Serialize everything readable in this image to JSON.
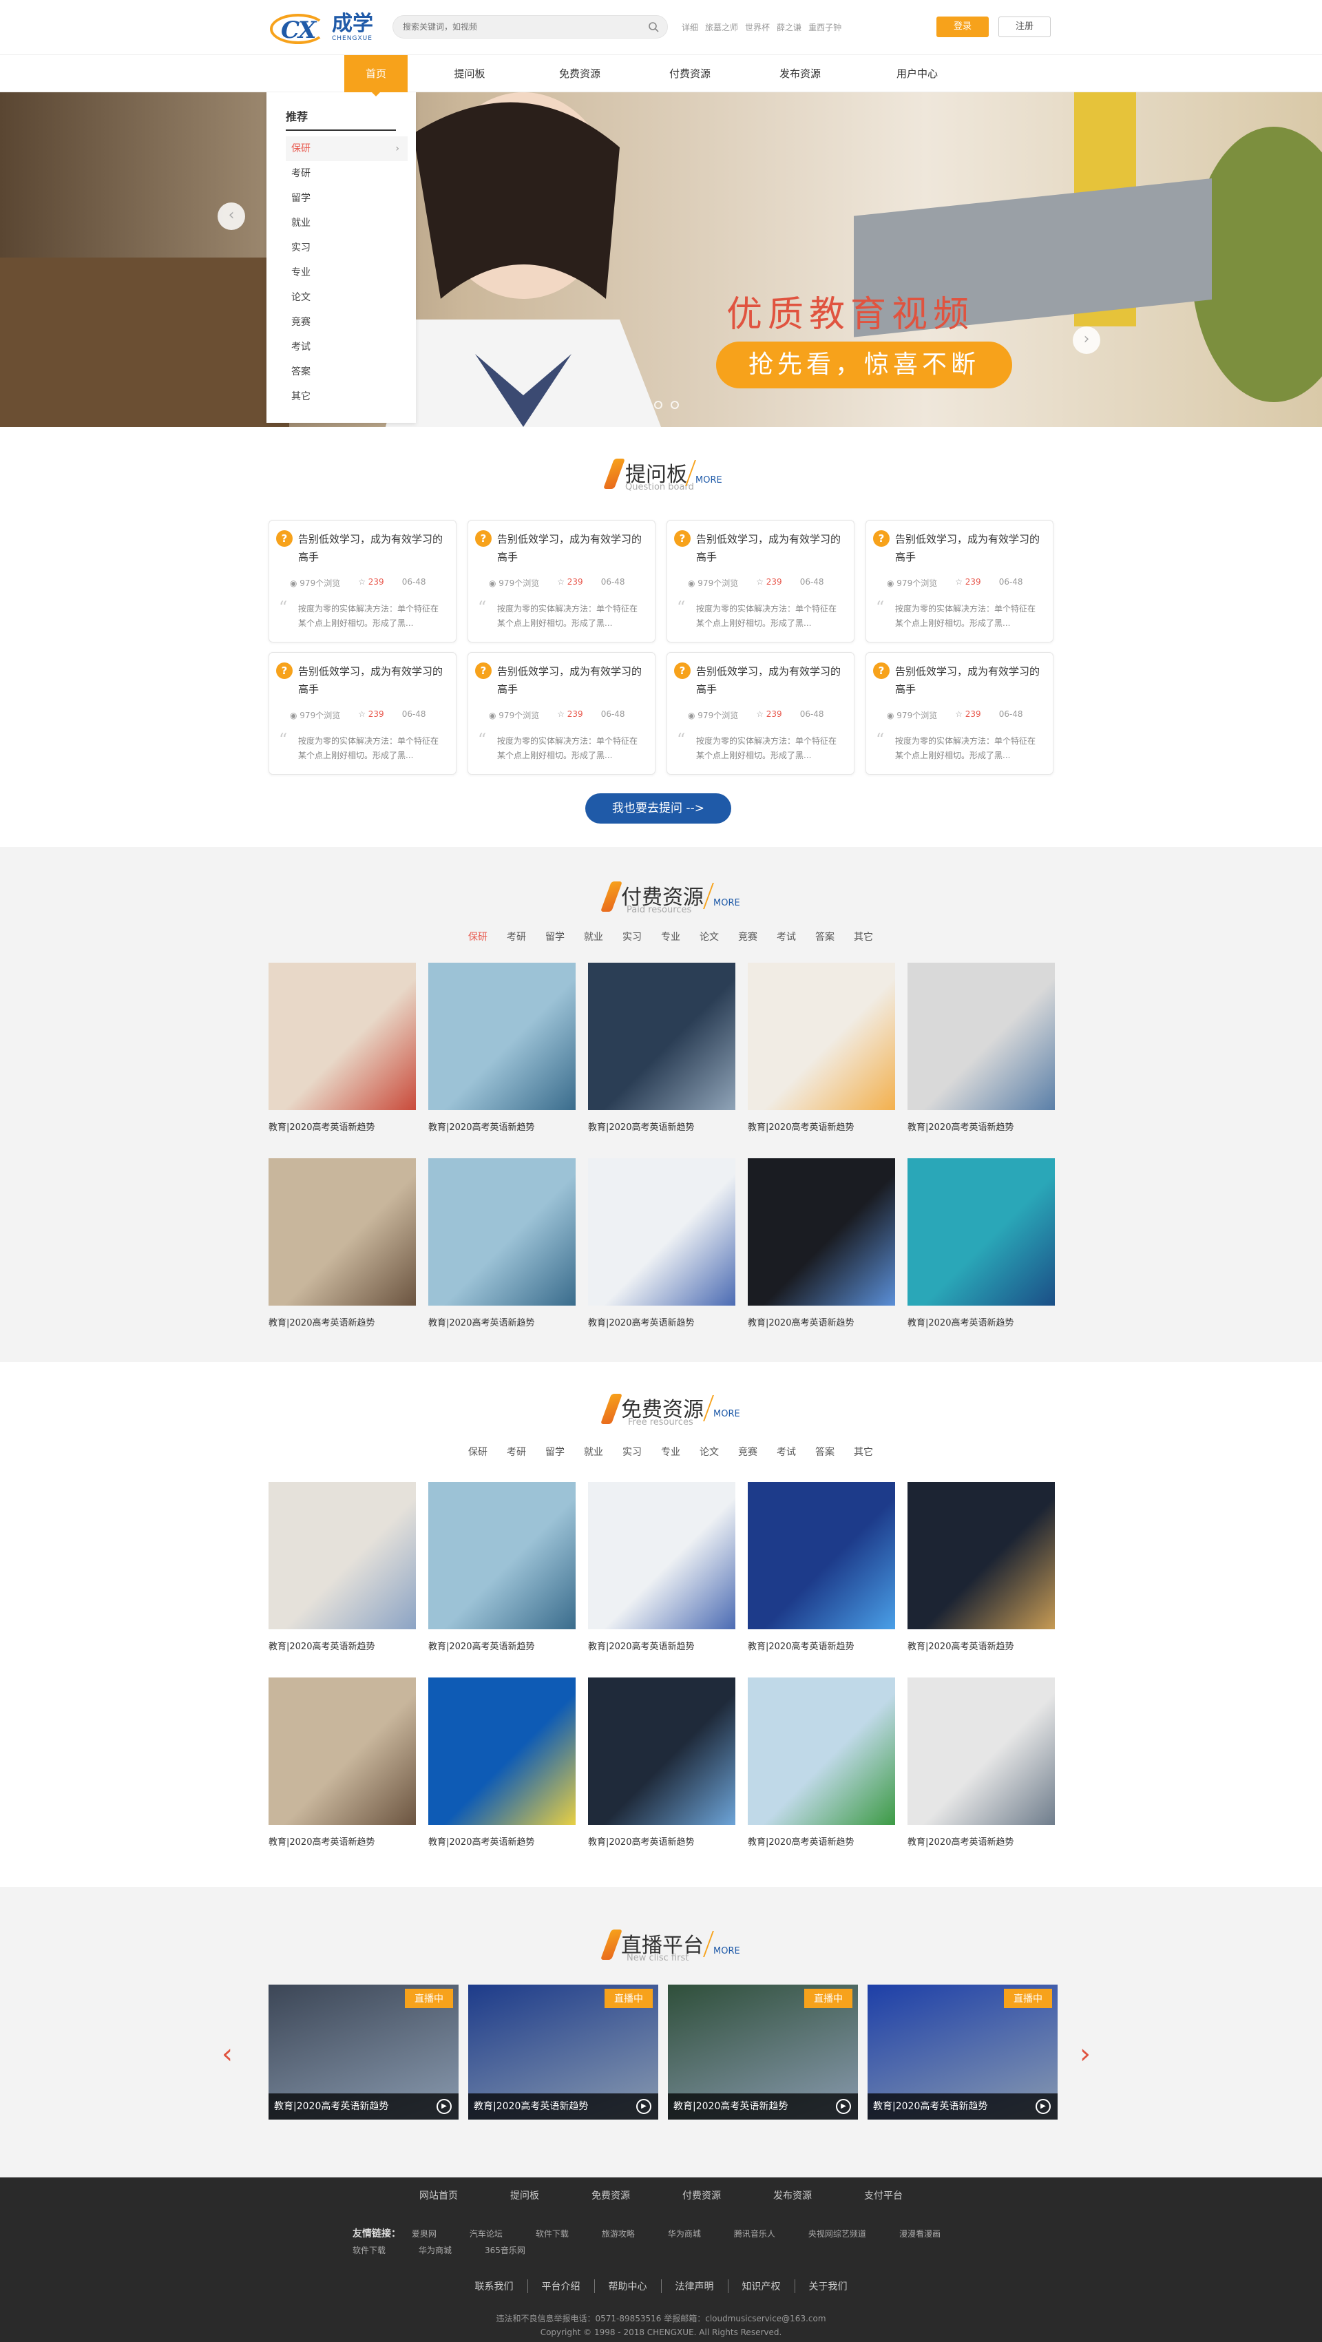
{
  "header": {
    "logo": {
      "mark": "CX",
      "cn": "成学",
      "en": "CHENGXUE"
    },
    "search": {
      "placeholder": "搜索关键词，如视频"
    },
    "hotwords": [
      "详细",
      "旅墓之师",
      "世界杯",
      "薛之谦",
      "重西子钟"
    ],
    "login_label": "登录",
    "register_label": "注册"
  },
  "nav": {
    "items": [
      "首页",
      "提问板",
      "免费资源",
      "付费资源",
      "发布资源",
      "用户中心"
    ],
    "active_index": 0
  },
  "banner": {
    "slogan_main": "优质教育视频",
    "slogan_sub": "抢先看，惊喜不断",
    "dropdown": {
      "title": "推荐",
      "items": [
        "保研",
        "考研",
        "留学",
        "就业",
        "实习",
        "专业",
        "论文",
        "竞赛",
        "考试",
        "答案",
        "其它"
      ],
      "active_index": 0
    },
    "prev_icon": "chevron-left-icon",
    "next_icon": "chevron-right-icon",
    "slide_count": 2
  },
  "questions": {
    "title": "提问板",
    "subtitle": "Question board",
    "more": "MORE",
    "cards": [
      {
        "title": "告别低效学习，成为有效学习的高手",
        "views": "979个浏览",
        "stars": "239",
        "time": "06-48",
        "desc": "按度为零的实体解决方法：单个特征在某个点上刚好相切。形成了黑..."
      },
      {
        "title": "告别低效学习，成为有效学习的高手",
        "views": "979个浏览",
        "stars": "239",
        "time": "06-48",
        "desc": "按度为零的实体解决方法：单个特征在某个点上刚好相切。形成了黑..."
      },
      {
        "title": "告别低效学习，成为有效学习的高手",
        "views": "979个浏览",
        "stars": "239",
        "time": "06-48",
        "desc": "按度为零的实体解决方法：单个特征在某个点上刚好相切。形成了黑..."
      },
      {
        "title": "告别低效学习，成为有效学习的高手",
        "views": "979个浏览",
        "stars": "239",
        "time": "06-48",
        "desc": "按度为零的实体解决方法：单个特征在某个点上刚好相切。形成了黑..."
      },
      {
        "title": "告别低效学习，成为有效学习的高手",
        "views": "979个浏览",
        "stars": "239",
        "time": "06-48",
        "desc": "按度为零的实体解决方法：单个特征在某个点上刚好相切。形成了黑..."
      },
      {
        "title": "告别低效学习，成为有效学习的高手",
        "views": "979个浏览",
        "stars": "239",
        "time": "06-48",
        "desc": "按度为零的实体解决方法：单个特征在某个点上刚好相切。形成了黑..."
      },
      {
        "title": "告别低效学习，成为有效学习的高手",
        "views": "979个浏览",
        "stars": "239",
        "time": "06-48",
        "desc": "按度为零的实体解决方法：单个特征在某个点上刚好相切。形成了黑..."
      },
      {
        "title": "告别低效学习，成为有效学习的高手",
        "views": "979个浏览",
        "stars": "239",
        "time": "06-48",
        "desc": "按度为零的实体解决方法：单个特征在某个点上刚好相切。形成了黑..."
      }
    ],
    "ask_button": "我也要去提问 -->"
  },
  "paid": {
    "title": "付费资源",
    "subtitle": "Paid resources",
    "more": "MORE",
    "tabs": [
      "保研",
      "考研",
      "留学",
      "就业",
      "实习",
      "专业",
      "论文",
      "竞赛",
      "考试",
      "答案",
      "其它"
    ],
    "active_tab": 0,
    "items": [
      {
        "caption": "教育|2020高考英语新趋势"
      },
      {
        "caption": "教育|2020高考英语新趋势"
      },
      {
        "caption": "教育|2020高考英语新趋势"
      },
      {
        "caption": "教育|2020高考英语新趋势"
      },
      {
        "caption": "教育|2020高考英语新趋势"
      },
      {
        "caption": "教育|2020高考英语新趋势"
      },
      {
        "caption": "教育|2020高考英语新趋势"
      },
      {
        "caption": "教育|2020高考英语新趋势"
      },
      {
        "caption": "教育|2020高考英语新趋势"
      },
      {
        "caption": "教育|2020高考英语新趋势"
      }
    ]
  },
  "free": {
    "title": "免费资源",
    "subtitle": "Free resources",
    "more": "MORE",
    "tabs": [
      "保研",
      "考研",
      "留学",
      "就业",
      "实习",
      "专业",
      "论文",
      "竞赛",
      "考试",
      "答案",
      "其它"
    ],
    "items": [
      {
        "caption": "教育|2020高考英语新趋势"
      },
      {
        "caption": "教育|2020高考英语新趋势"
      },
      {
        "caption": "教育|2020高考英语新趋势"
      },
      {
        "caption": "教育|2020高考英语新趋势"
      },
      {
        "caption": "教育|2020高考英语新趋势"
      },
      {
        "caption": "教育|2020高考英语新趋势"
      },
      {
        "caption": "教育|2020高考英语新趋势"
      },
      {
        "caption": "教育|2020高考英语新趋势"
      },
      {
        "caption": "教育|2020高考英语新趋势"
      },
      {
        "caption": "教育|2020高考英语新趋势"
      }
    ]
  },
  "live": {
    "title": "直播平台",
    "subtitle": "New clisc first",
    "more": "MORE",
    "badge": "直播中",
    "cards": [
      {
        "caption": "教育|2020高考英语新趋势"
      },
      {
        "caption": "教育|2020高考英语新趋势"
      },
      {
        "caption": "教育|2020高考英语新趋势"
      },
      {
        "caption": "教育|2020高考英语新趋势"
      }
    ]
  },
  "footer": {
    "nav": [
      "网站首页",
      "提问板",
      "免费资源",
      "付费资源",
      "发布资源",
      "支付平台"
    ],
    "links_label": "友情链接：",
    "links": [
      "爱奥网",
      "汽车论坛",
      "软件下载",
      "旅游攻略",
      "华为商城",
      "腾讯音乐人",
      "央视网综艺频道",
      "漫漫看漫画",
      "软件下载",
      "华为商城",
      "365音乐网"
    ],
    "bottom": [
      "联系我们",
      "平台介绍",
      "帮助中心",
      "法律声明",
      "知识产权",
      "关于我们"
    ],
    "contact": "违法和不良信息举报电话：0571-89853516 举报邮箱：cloudmusicservice@163.com",
    "copyright": "Copyright © 1998 - 2018 CHENGXUE. All Rights Reserved."
  },
  "colors": {
    "accent": "#f7a21b",
    "brand": "#1f5aa8",
    "highlight": "#e85a4f"
  }
}
